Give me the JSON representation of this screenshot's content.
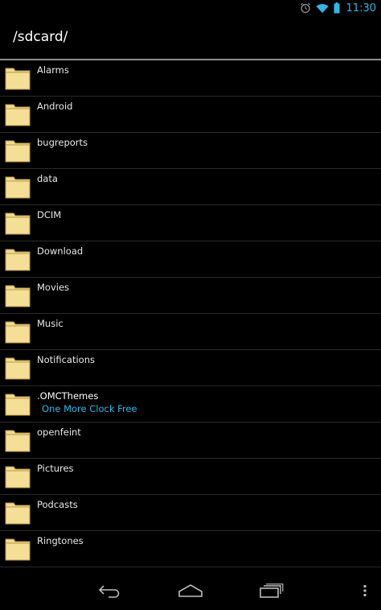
{
  "status_bar": {
    "time": "11:30",
    "icons": [
      "alarm-icon",
      "wifi-icon",
      "battery-icon"
    ],
    "accent_color": "#33b5e5"
  },
  "title_bar": {
    "path": "/sdcard/"
  },
  "files": [
    {
      "name": "Alarms",
      "subtitle": ""
    },
    {
      "name": "Android",
      "subtitle": ""
    },
    {
      "name": "bugreports",
      "subtitle": ""
    },
    {
      "name": "data",
      "subtitle": ""
    },
    {
      "name": "DCIM",
      "subtitle": ""
    },
    {
      "name": "Download",
      "subtitle": ""
    },
    {
      "name": "Movies",
      "subtitle": ""
    },
    {
      "name": "Music",
      "subtitle": ""
    },
    {
      "name": "Notifications",
      "subtitle": ""
    },
    {
      "name": ".OMCThemes",
      "subtitle": "One More Clock Free"
    },
    {
      "name": "openfeint",
      "subtitle": ""
    },
    {
      "name": "Pictures",
      "subtitle": ""
    },
    {
      "name": "Podcasts",
      "subtitle": ""
    },
    {
      "name": "Ringtones",
      "subtitle": ""
    }
  ],
  "nav_bar": {
    "icons": [
      "back-icon",
      "home-icon",
      "recent-apps-icon",
      "overflow-menu-icon"
    ]
  },
  "colors": {
    "folder_fill": "#f2d98c",
    "folder_stroke": "#b89a4a",
    "subtitle": "#33b5e5"
  }
}
